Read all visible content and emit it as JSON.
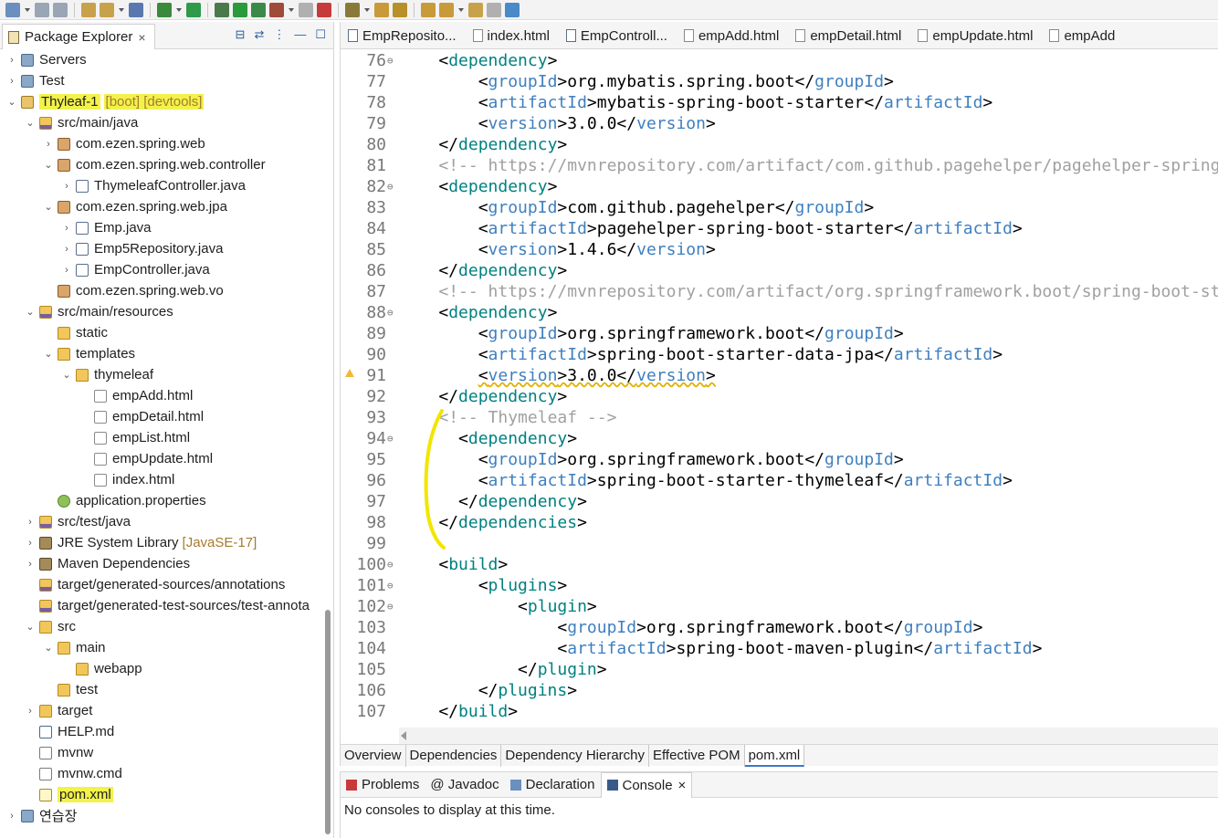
{
  "toolbar": {
    "icons": [
      "new-icon",
      "save-icon",
      "save-all-icon",
      "open-type-icon",
      "open-resource-icon",
      "console-icon",
      "skip-breakpoints-icon",
      "spring-boot-icon",
      "debug-icon",
      "run-icon",
      "coverage-icon",
      "external-tools-icon",
      "stop-icon",
      "new-java-class-icon",
      "search-icon",
      "open-task-icon",
      "annotation-icon",
      "next-annotation-icon",
      "prev-annotation-icon",
      "back-icon",
      "forward-icon",
      "open-perspective-icon"
    ]
  },
  "package_explorer": {
    "title": "Package Explorer",
    "close": "×",
    "items": [
      {
        "label": "Servers",
        "indent": 0,
        "twisty": ">",
        "icon": "server-icon",
        "icon_class": "ic-server"
      },
      {
        "label": "Test",
        "indent": 0,
        "twisty": ">",
        "icon": "project-icon",
        "icon_class": "ic-server"
      },
      {
        "label": "Thyleaf-1",
        "decor": "[boot] [devtools]",
        "indent": 0,
        "twisty": "v",
        "icon": "project-icon",
        "icon_class": "ic-project",
        "highlight": true
      },
      {
        "label": "src/main/java",
        "indent": 1,
        "twisty": "v",
        "icon": "source-folder-icon",
        "icon_class": "ic-srcfolder"
      },
      {
        "label": "com.ezen.spring.web",
        "indent": 2,
        "twisty": ">",
        "icon": "package-icon",
        "icon_class": "ic-package"
      },
      {
        "label": "com.ezen.spring.web.controller",
        "indent": 2,
        "twisty": "v",
        "icon": "package-icon",
        "icon_class": "ic-package"
      },
      {
        "label": "ThymeleafController.java",
        "indent": 3,
        "twisty": ">",
        "icon": "java-file-icon",
        "icon_class": "ic-java"
      },
      {
        "label": "com.ezen.spring.web.jpa",
        "indent": 2,
        "twisty": "v",
        "icon": "package-icon",
        "icon_class": "ic-package"
      },
      {
        "label": "Emp.java",
        "indent": 3,
        "twisty": ">",
        "icon": "java-file-icon",
        "icon_class": "ic-java"
      },
      {
        "label": "Emp5Repository.java",
        "indent": 3,
        "twisty": ">",
        "icon": "java-file-icon",
        "icon_class": "ic-java"
      },
      {
        "label": "EmpController.java",
        "indent": 3,
        "twisty": ">",
        "icon": "java-file-icon",
        "icon_class": "ic-java"
      },
      {
        "label": "com.ezen.spring.web.vo",
        "indent": 2,
        "twisty": "",
        "icon": "package-icon",
        "icon_class": "ic-package"
      },
      {
        "label": "src/main/resources",
        "indent": 1,
        "twisty": "v",
        "icon": "source-folder-icon",
        "icon_class": "ic-srcfolder"
      },
      {
        "label": "static",
        "indent": 2,
        "twisty": "",
        "icon": "folder-icon",
        "icon_class": "ic-folder"
      },
      {
        "label": "templates",
        "indent": 2,
        "twisty": "v",
        "icon": "folder-icon",
        "icon_class": "ic-folder"
      },
      {
        "label": "thymeleaf",
        "indent": 3,
        "twisty": "v",
        "icon": "folder-icon",
        "icon_class": "ic-folder"
      },
      {
        "label": "empAdd.html",
        "indent": 4,
        "twisty": "",
        "icon": "html-file-icon",
        "icon_class": "ic-html"
      },
      {
        "label": "empDetail.html",
        "indent": 4,
        "twisty": "",
        "icon": "html-file-icon",
        "icon_class": "ic-html"
      },
      {
        "label": "empList.html",
        "indent": 4,
        "twisty": "",
        "icon": "html-file-icon",
        "icon_class": "ic-html"
      },
      {
        "label": "empUpdate.html",
        "indent": 4,
        "twisty": "",
        "icon": "html-file-icon",
        "icon_class": "ic-html"
      },
      {
        "label": "index.html",
        "indent": 4,
        "twisty": "",
        "icon": "html-file-icon",
        "icon_class": "ic-html"
      },
      {
        "label": "application.properties",
        "indent": 2,
        "twisty": "",
        "icon": "properties-file-icon",
        "icon_class": "ic-props"
      },
      {
        "label": "src/test/java",
        "indent": 1,
        "twisty": ">",
        "icon": "source-folder-icon",
        "icon_class": "ic-srcfolder"
      },
      {
        "label": "JRE System Library",
        "decor": "[JavaSE-17]",
        "indent": 1,
        "twisty": ">",
        "icon": "library-icon",
        "icon_class": "ic-lib"
      },
      {
        "label": "Maven Dependencies",
        "indent": 1,
        "twisty": ">",
        "icon": "library-icon",
        "icon_class": "ic-lib"
      },
      {
        "label": "target/generated-sources/annotations",
        "indent": 1,
        "twisty": "",
        "icon": "source-folder-icon",
        "icon_class": "ic-srcfolder"
      },
      {
        "label": "target/generated-test-sources/test-annota",
        "indent": 1,
        "twisty": "",
        "icon": "source-folder-icon",
        "icon_class": "ic-srcfolder"
      },
      {
        "label": "src",
        "indent": 1,
        "twisty": "v",
        "icon": "folder-icon",
        "icon_class": "ic-folder"
      },
      {
        "label": "main",
        "indent": 2,
        "twisty": "v",
        "icon": "folder-icon",
        "icon_class": "ic-folder"
      },
      {
        "label": "webapp",
        "indent": 3,
        "twisty": "",
        "icon": "folder-icon",
        "icon_class": "ic-folder"
      },
      {
        "label": "test",
        "indent": 2,
        "twisty": "",
        "icon": "folder-icon",
        "icon_class": "ic-folder"
      },
      {
        "label": "target",
        "indent": 1,
        "twisty": ">",
        "icon": "folder-icon",
        "icon_class": "ic-folder"
      },
      {
        "label": "HELP.md",
        "indent": 1,
        "twisty": "",
        "icon": "md-file-icon",
        "icon_class": "ic-mdfile"
      },
      {
        "label": "mvnw",
        "indent": 1,
        "twisty": "",
        "icon": "file-icon",
        "icon_class": "ic-file"
      },
      {
        "label": "mvnw.cmd",
        "indent": 1,
        "twisty": "",
        "icon": "file-icon",
        "icon_class": "ic-file"
      },
      {
        "label": "pom.xml",
        "indent": 1,
        "twisty": "",
        "icon": "xml-file-icon",
        "icon_class": "ic-xml",
        "highlight": true
      },
      {
        "label": "연습장",
        "indent": 0,
        "twisty": ">",
        "icon": "project-icon",
        "icon_class": "ic-server"
      }
    ]
  },
  "editor_tabs": [
    {
      "label": "EmpReposito...",
      "kind": "java"
    },
    {
      "label": "index.html",
      "kind": "html"
    },
    {
      "label": "EmpControll...",
      "kind": "java"
    },
    {
      "label": "empAdd.html",
      "kind": "html"
    },
    {
      "label": "empDetail.html",
      "kind": "html"
    },
    {
      "label": "empUpdate.html",
      "kind": "html"
    },
    {
      "label": "empAdd",
      "kind": "html"
    }
  ],
  "code_lines": [
    {
      "num": "76",
      "fold": "⊖",
      "html": "    &lt;<span class='b'>dependency</span>&gt;"
    },
    {
      "num": "77",
      "html": "        &lt;<span class='t'>groupId</span>&gt;org.mybatis.spring.boot&lt;/<span class='t'>groupId</span>&gt;"
    },
    {
      "num": "78",
      "html": "        &lt;<span class='t'>artifactId</span>&gt;mybatis-spring-boot-starter&lt;/<span class='t'>artifactId</span>&gt;"
    },
    {
      "num": "79",
      "html": "        &lt;<span class='t'>version</span>&gt;3.0.0&lt;/<span class='t'>version</span>&gt;"
    },
    {
      "num": "80",
      "html": "    &lt;/<span class='b'>dependency</span>&gt;"
    },
    {
      "num": "81",
      "html": "    <span class='cm'>&lt;!-- https://mvnrepository.com/artifact/com.github.pagehelper/pagehelper-spring-boot-starter --&gt;</span>"
    },
    {
      "num": "82",
      "fold": "⊖",
      "html": "    &lt;<span class='b'>dependency</span>&gt;"
    },
    {
      "num": "83",
      "html": "        &lt;<span class='t'>groupId</span>&gt;com.github.pagehelper&lt;/<span class='t'>groupId</span>&gt;"
    },
    {
      "num": "84",
      "html": "        &lt;<span class='t'>artifactId</span>&gt;pagehelper-spring-boot-starter&lt;/<span class='t'>artifactId</span>&gt;"
    },
    {
      "num": "85",
      "html": "        &lt;<span class='t'>version</span>&gt;1.4.6&lt;/<span class='t'>version</span>&gt;"
    },
    {
      "num": "86",
      "html": "    &lt;/<span class='b'>dependency</span>&gt;"
    },
    {
      "num": "87",
      "html": "    <span class='cm'>&lt;!-- https://mvnrepository.com/artifact/org.springframework.boot/spring-boot-starter-data-jpa --&gt;</span>"
    },
    {
      "num": "88",
      "fold": "⊖",
      "html": "    &lt;<span class='b'>dependency</span>&gt;"
    },
    {
      "num": "89",
      "html": "        &lt;<span class='t'>groupId</span>&gt;org.springframework.boot&lt;/<span class='t'>groupId</span>&gt;"
    },
    {
      "num": "90",
      "html": "        &lt;<span class='t'>artifactId</span>&gt;spring-boot-starter-data-jpa&lt;/<span class='t'>artifactId</span>&gt;"
    },
    {
      "num": "91",
      "warn": true,
      "html": "        <span class='sq'>&lt;<span class='t'>version</span>&gt;3.0.0&lt;/<span class='t'>version</span>&gt;</span>"
    },
    {
      "num": "92",
      "html": "    &lt;/<span class='b'>dependency</span>&gt;"
    },
    {
      "num": "93",
      "html": "    <span class='cm'>&lt;!-- Thymeleaf --&gt;</span>"
    },
    {
      "num": "94",
      "fold": "⊖",
      "html": "      &lt;<span class='b'>dependency</span>&gt;"
    },
    {
      "num": "95",
      "html": "        &lt;<span class='t'>groupId</span>&gt;org.springframework.boot&lt;/<span class='t'>groupId</span>&gt;"
    },
    {
      "num": "96",
      "html": "        &lt;<span class='t'>artifactId</span>&gt;spring-boot-starter-thymeleaf&lt;/<span class='t'>artifactId</span>&gt;"
    },
    {
      "num": "97",
      "html": "      &lt;/<span class='b'>dependency</span>&gt;"
    },
    {
      "num": "98",
      "html": "    &lt;/<span class='b'>dependencies</span>&gt;"
    },
    {
      "num": "99",
      "html": ""
    },
    {
      "num": "100",
      "fold": "⊖",
      "html": "    &lt;<span class='b'>build</span>&gt;"
    },
    {
      "num": "101",
      "fold": "⊖",
      "html": "        &lt;<span class='b'>plugins</span>&gt;"
    },
    {
      "num": "102",
      "fold": "⊖",
      "html": "            &lt;<span class='b'>plugin</span>&gt;"
    },
    {
      "num": "103",
      "html": "                &lt;<span class='t'>groupId</span>&gt;org.springframework.boot&lt;/<span class='t'>groupId</span>&gt;"
    },
    {
      "num": "104",
      "html": "                &lt;<span class='t'>artifactId</span>&gt;spring-boot-maven-plugin&lt;/<span class='t'>artifactId</span>&gt;"
    },
    {
      "num": "105",
      "html": "            &lt;/<span class='b'>plugin</span>&gt;"
    },
    {
      "num": "106",
      "html": "        &lt;/<span class='b'>plugins</span>&gt;"
    },
    {
      "num": "107",
      "html": "    &lt;/<span class='b'>build</span>&gt;"
    }
  ],
  "pom_tabs": [
    {
      "label": "Overview"
    },
    {
      "label": "Dependencies"
    },
    {
      "label": "Dependency Hierarchy"
    },
    {
      "label": "Effective POM"
    },
    {
      "label": "pom.xml",
      "active": true
    }
  ],
  "bottom_tabs": [
    {
      "label": "Problems",
      "icon": "problems-icon"
    },
    {
      "label": "@ Javadoc",
      "icon": "javadoc-icon"
    },
    {
      "label": "Declaration",
      "icon": "declaration-icon"
    },
    {
      "label": "Console",
      "icon": "console-icon",
      "active": true,
      "close": "×"
    }
  ],
  "console_message": "No consoles to display at this time.",
  "colors": {
    "highlight": "#f2f24a",
    "tag_name": "#3f7fbf",
    "block_tag": "#008080",
    "comment": "#a0a0a0"
  }
}
